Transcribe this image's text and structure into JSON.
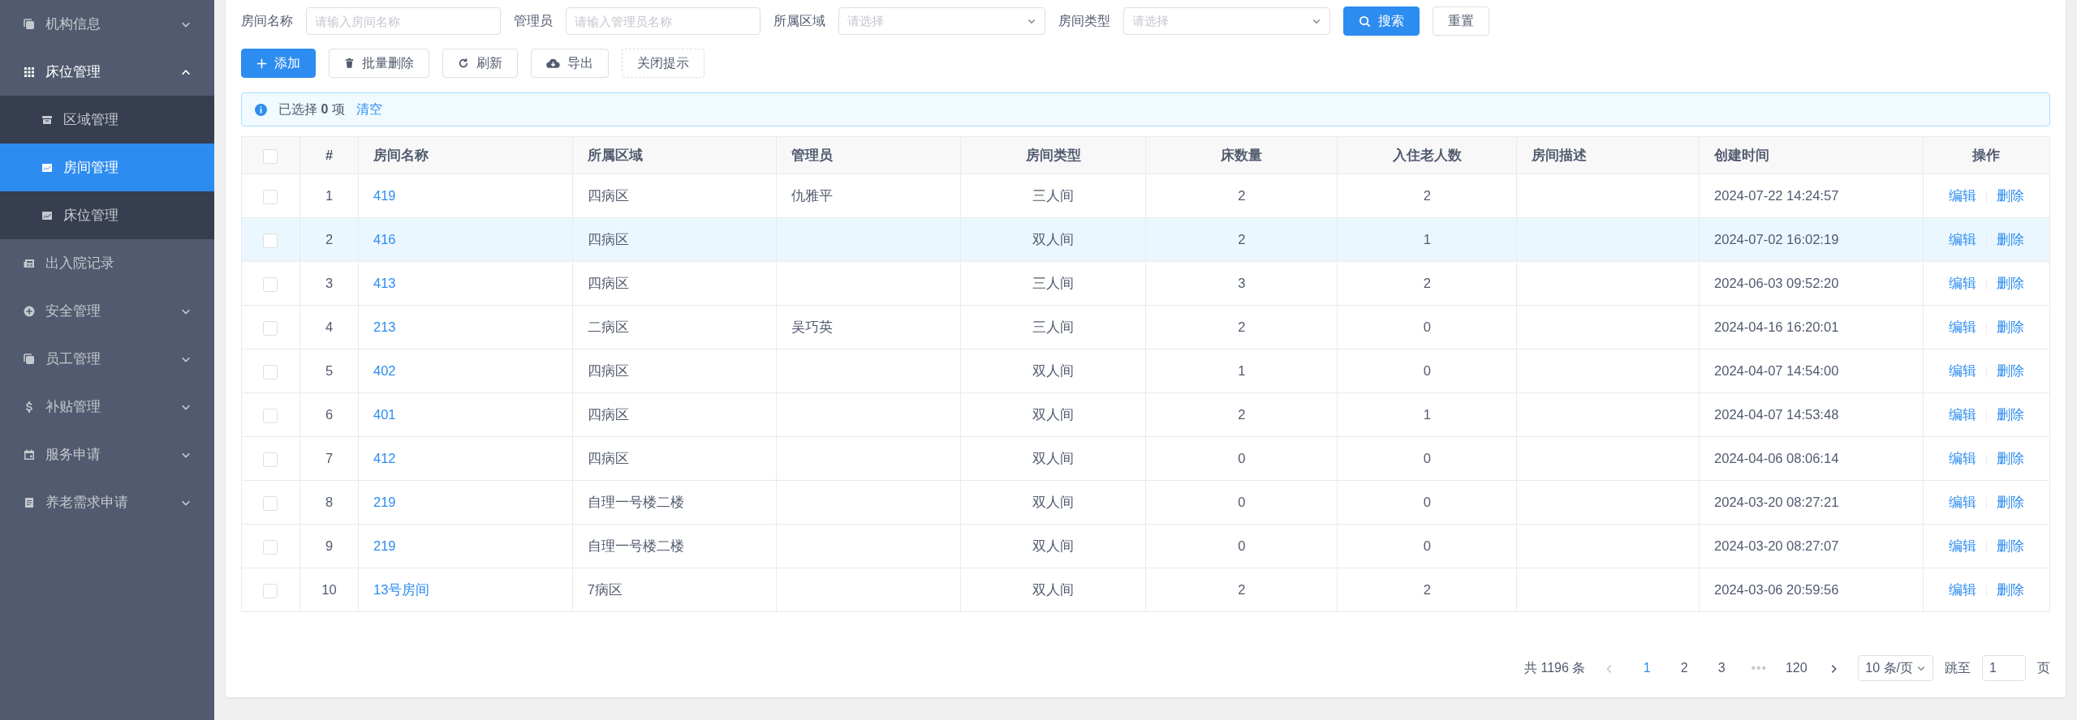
{
  "sidebar": {
    "items": [
      {
        "label": "机构信息",
        "expanded": false,
        "selected": false
      },
      {
        "label": "床位管理",
        "expanded": true,
        "selected": false,
        "children": [
          {
            "label": "区域管理",
            "selected": false
          },
          {
            "label": "房间管理",
            "selected": true
          },
          {
            "label": "床位管理",
            "selected": false
          }
        ]
      },
      {
        "label": "出入院记录",
        "selected": false
      },
      {
        "label": "安全管理",
        "expanded": false,
        "selected": false
      },
      {
        "label": "员工管理",
        "expanded": false,
        "selected": false
      },
      {
        "label": "补贴管理",
        "expanded": false,
        "selected": false
      },
      {
        "label": "服务申请",
        "expanded": false,
        "selected": false
      },
      {
        "label": "养老需求申请",
        "expanded": false,
        "selected": false
      }
    ]
  },
  "filters": [
    {
      "label": "房间名称",
      "kind": "input",
      "placeholder": "请输入房间名称"
    },
    {
      "label": "管理员",
      "kind": "input",
      "placeholder": "请输入管理员名称"
    },
    {
      "label": "所属区域",
      "kind": "select",
      "placeholder": "请选择"
    },
    {
      "label": "房间类型",
      "kind": "select",
      "placeholder": "请选择"
    }
  ],
  "filter_buttons": [
    {
      "label": "搜索",
      "kind": "primary"
    },
    {
      "label": "重置",
      "kind": "default"
    }
  ],
  "toolbar": [
    {
      "label": "添加",
      "kind": "primary"
    },
    {
      "label": "批量删除",
      "kind": "default"
    },
    {
      "label": "刷新",
      "kind": "default"
    },
    {
      "label": "导出",
      "kind": "default"
    },
    {
      "label": "关闭提示",
      "kind": "dashed"
    }
  ],
  "alert": {
    "text": "已选择 **0** 项",
    "link": "清空"
  },
  "table": {
    "all_checked": false,
    "columns": [
      "#",
      "房间名称",
      "所属区域",
      "管理员",
      "房间类型",
      "床数量",
      "入住老人数",
      "房间描述",
      "创建时间",
      "操作"
    ],
    "rows": [
      {
        "checked": false,
        "highlighted": false,
        "cells": [
          "1",
          "419",
          "四病区",
          "仇雅平",
          "三人间",
          "2",
          "2",
          "",
          "2024-07-22 14:24:57"
        ],
        "actions": [
          "编辑",
          "删除"
        ]
      },
      {
        "checked": false,
        "highlighted": true,
        "cells": [
          "2",
          "416",
          "四病区",
          "",
          "双人间",
          "2",
          "1",
          "",
          "2024-07-02 16:02:19"
        ],
        "actions": [
          "编辑",
          "删除"
        ]
      },
      {
        "checked": false,
        "highlighted": false,
        "cells": [
          "3",
          "413",
          "四病区",
          "",
          "三人间",
          "3",
          "2",
          "",
          "2024-06-03 09:52:20"
        ],
        "actions": [
          "编辑",
          "删除"
        ]
      },
      {
        "checked": false,
        "highlighted": false,
        "cells": [
          "4",
          "213",
          "二病区",
          "吴巧英",
          "三人间",
          "2",
          "0",
          "",
          "2024-04-16 16:20:01"
        ],
        "actions": [
          "编辑",
          "删除"
        ]
      },
      {
        "checked": false,
        "highlighted": false,
        "cells": [
          "5",
          "402",
          "四病区",
          "",
          "双人间",
          "1",
          "0",
          "",
          "2024-04-07 14:54:00"
        ],
        "actions": [
          "编辑",
          "删除"
        ]
      },
      {
        "checked": false,
        "highlighted": false,
        "cells": [
          "6",
          "401",
          "四病区",
          "",
          "双人间",
          "2",
          "1",
          "",
          "2024-04-07 14:53:48"
        ],
        "actions": [
          "编辑",
          "删除"
        ]
      },
      {
        "checked": false,
        "highlighted": false,
        "cells": [
          "7",
          "412",
          "四病区",
          "",
          "双人间",
          "0",
          "0",
          "",
          "2024-04-06 08:06:14"
        ],
        "actions": [
          "编辑",
          "删除"
        ]
      },
      {
        "checked": false,
        "highlighted": false,
        "cells": [
          "8",
          "219",
          "自理一号楼二楼",
          "",
          "双人间",
          "0",
          "0",
          "",
          "2024-03-20 08:27:21"
        ],
        "actions": [
          "编辑",
          "删除"
        ]
      },
      {
        "checked": false,
        "highlighted": false,
        "cells": [
          "9",
          "219",
          "自理一号楼二楼",
          "",
          "双人间",
          "0",
          "0",
          "",
          "2024-03-20 08:27:07"
        ],
        "actions": [
          "编辑",
          "删除"
        ]
      },
      {
        "checked": false,
        "highlighted": false,
        "cells": [
          "10",
          "13号房间",
          "7病区",
          "",
          "双人间",
          "2",
          "2",
          "",
          "2024-03-06 20:59:56"
        ],
        "actions": [
          "编辑",
          "删除"
        ]
      }
    ]
  },
  "pagination": {
    "total": "共 1196 条",
    "prev_disabled": true,
    "pages": [
      {
        "label": "1",
        "kind": "page",
        "selected": true
      },
      {
        "label": "2",
        "kind": "page",
        "selected": false
      },
      {
        "label": "3",
        "kind": "page",
        "selected": false
      },
      {
        "label": "•••",
        "kind": "ellipsis"
      },
      {
        "label": "120",
        "kind": "page",
        "selected": false
      }
    ],
    "page_size": "10 条/页",
    "jump_label": "跳至",
    "jump_value": "1",
    "jump_suffix": "页"
  }
}
